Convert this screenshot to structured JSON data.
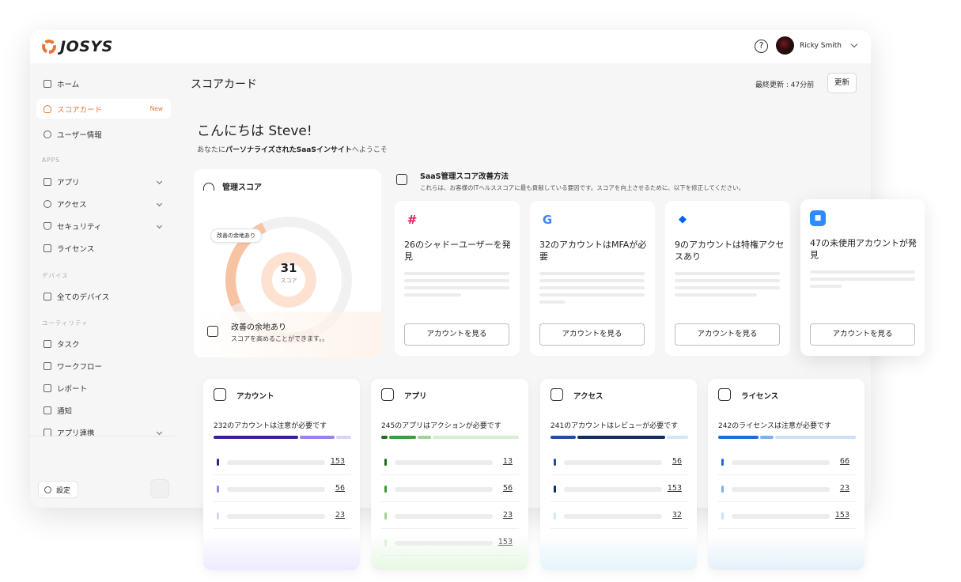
{
  "app": {
    "logo_text": "JOSYS",
    "brand_color": "#e8773a"
  },
  "header": {
    "help_icon": "?",
    "user_name": "Ricky Smith"
  },
  "sidebar": {
    "items": [
      {
        "label": "ホーム",
        "icon": "home-icon"
      },
      {
        "label": "スコアカード",
        "badge": "New",
        "icon": "gauge-icon",
        "active": true
      },
      {
        "label": "ユーザー情報",
        "icon": "user-icon"
      }
    ],
    "sections": {
      "apps": "APPS",
      "devices": "デバイス",
      "utilities": "ユーティリティ"
    },
    "apps_items": [
      {
        "label": "アプリ",
        "icon": "grid-icon"
      },
      {
        "label": "アクセス",
        "icon": "key-icon"
      },
      {
        "label": "セキュリティ",
        "icon": "shield-icon"
      },
      {
        "label": "ライセンス",
        "icon": "license-icon"
      }
    ],
    "device_items": [
      {
        "label": "全てのデバイス",
        "icon": "laptop-icon"
      }
    ],
    "utility_items": [
      {
        "label": "タスク",
        "icon": "task-icon"
      },
      {
        "label": "ワークフロー",
        "icon": "workflow-icon"
      },
      {
        "label": "レポート",
        "icon": "report-icon"
      },
      {
        "label": "通知",
        "icon": "chat-icon"
      },
      {
        "label": "アプリ連携",
        "icon": "link-icon"
      }
    ],
    "settings_label": "設定"
  },
  "main": {
    "page_title": "スコアカード",
    "updated_label": "最終更新 : 47分前",
    "refresh_label": "更新",
    "greeting": "こんにちは Steve!",
    "welcome_pre": "あなたに",
    "welcome_bold": "パーソナライズされたSaaSインサイト",
    "welcome_post": "へようこそ"
  },
  "score": {
    "title": "管理スコア",
    "value": "31",
    "value_label": "スコア",
    "pill": "改善の余地あり",
    "footer_title": "改善の余地あり",
    "footer_sub": "スコアを高めることができます。。",
    "fraction": 0.31
  },
  "improve": {
    "title": "SaaS管理スコア改善方法",
    "subtitle": "これらは、お客様のITヘルススコアに最も貢献している要因です。スコアを向上させるために、以下を修正してください。"
  },
  "app_cards": [
    {
      "app": "Slack",
      "logo": "#",
      "logo_color": "#e01e5a",
      "title": "26のシャドーユーザーを発見",
      "button": "アカウントを見る"
    },
    {
      "app": "Google",
      "logo": "G",
      "logo_color": "#4285f4",
      "title": "32のアカウントはMFAが必要",
      "button": "アカウントを見る"
    },
    {
      "app": "Dropbox",
      "logo": "◆",
      "logo_color": "#0061ff",
      "title": "9のアカウントは特権アクセスあり",
      "button": "アカウントを見る"
    },
    {
      "app": "Zoom",
      "logo": "■",
      "logo_color": "#2d8cff",
      "title": "47の未使用アカウントが発見",
      "button": "アカウントを見る"
    }
  ],
  "categories": [
    {
      "title": "アカウント",
      "icon": "account-icon",
      "summary": "232のアカウントは注意が必要です",
      "bar": [
        "#3d1f95",
        "#9b82e8",
        "#dcd3fb"
      ],
      "values": [
        "153",
        "56",
        "23"
      ],
      "dot_colors": [
        "#3d1f95",
        "#9b82e8",
        "#dcd3fb"
      ],
      "fade": "#efeaff"
    },
    {
      "title": "アプリ",
      "icon": "apps-icon",
      "summary": "245のアプリはアクションが必要です",
      "bar": [
        "#1f6e1d",
        "#3f9b3a",
        "#9fd494",
        "#d6efd0"
      ],
      "values": [
        "13",
        "56",
        "23",
        "153"
      ],
      "dot_colors": [
        "#1f6e1d",
        "#3f9b3a",
        "#9fd494",
        "#d6efd0"
      ],
      "fade": "#e8f8e4"
    },
    {
      "title": "アクセス",
      "icon": "access-icon",
      "summary": "241のアカウントはレビューが必要です",
      "bar": [
        "#1f4f9b",
        "#102c61",
        "#cfe7fa"
      ],
      "values": [
        "56",
        "153",
        "32"
      ],
      "dot_colors": [
        "#1f4f9b",
        "#102c61",
        "#cfe7fa"
      ],
      "fade": "#e6f4fc"
    },
    {
      "title": "ライセンス",
      "icon": "license-icon",
      "summary": "242のライセンスは注意が必要です",
      "bar": [
        "#1e6cd6",
        "#7ab2ee",
        "#cbe1f8"
      ],
      "values": [
        "66",
        "23",
        "153"
      ],
      "dot_colors": [
        "#1e6cd6",
        "#7ab2ee",
        "#cbe1f8"
      ],
      "fade": "#e6f0fb"
    }
  ]
}
